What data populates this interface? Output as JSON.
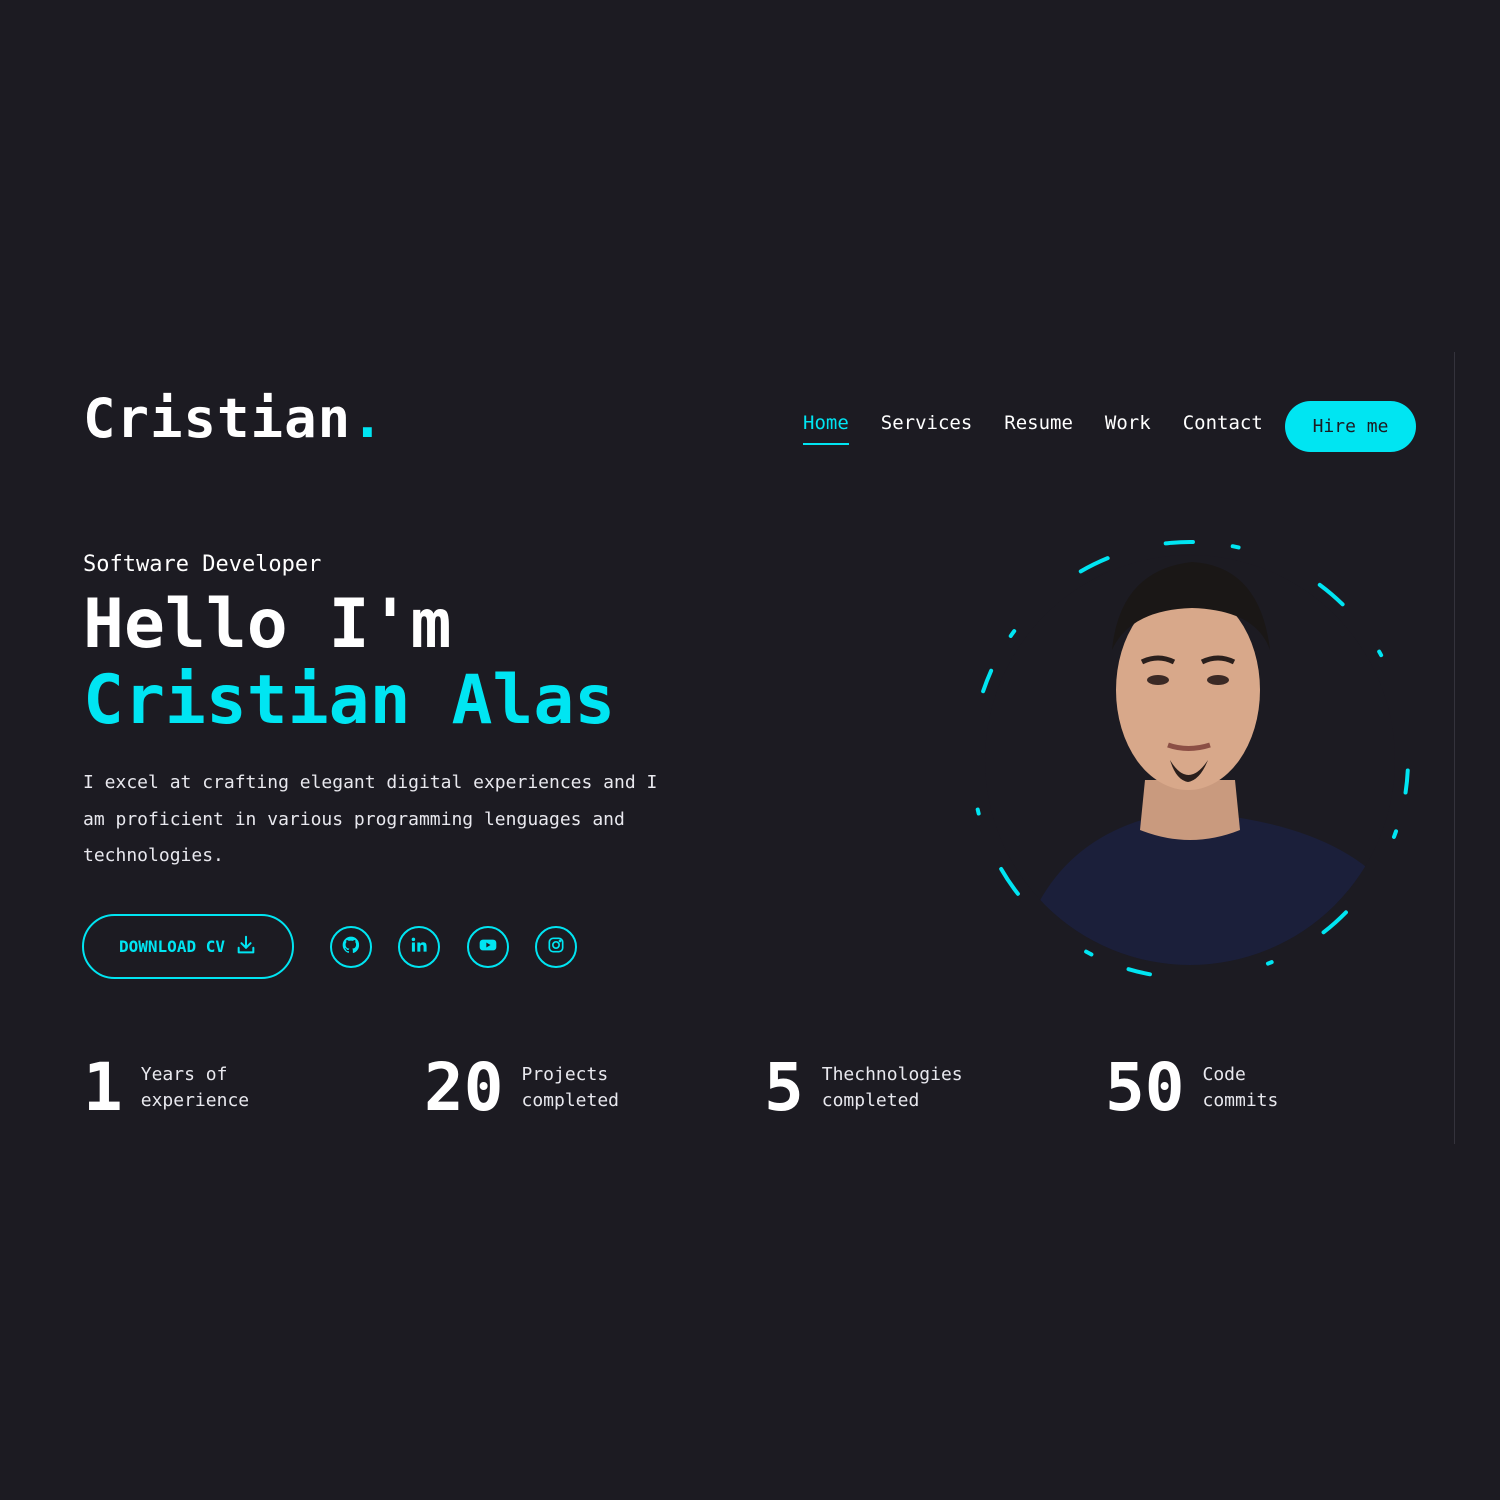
{
  "header": {
    "logo_text": "Cristian",
    "logo_dot": ".",
    "nav": [
      {
        "label": "Home",
        "active": true
      },
      {
        "label": "Services",
        "active": false
      },
      {
        "label": "Resume",
        "active": false
      },
      {
        "label": "Work",
        "active": false
      },
      {
        "label": "Contact",
        "active": false
      }
    ],
    "hire_label": "Hire me"
  },
  "hero": {
    "role": "Software Developer",
    "greeting": "Hello I'm",
    "name": "Cristian Alas",
    "description": "I excel at crafting elegant digital experiences and I am proficient in various programming lenguages and technologies.",
    "download_label": "DOWNLOAD CV",
    "socials": [
      {
        "icon": "github-icon"
      },
      {
        "icon": "linkedin-icon"
      },
      {
        "icon": "youtube-icon"
      },
      {
        "icon": "instagram-icon"
      }
    ]
  },
  "stats": [
    {
      "value": "1",
      "label": "Years of experience"
    },
    {
      "value": "20",
      "label": "Projects completed"
    },
    {
      "value": "5",
      "label": "Thechnologies completed"
    },
    {
      "value": "50",
      "label": "Code commits"
    }
  ],
  "colors": {
    "accent": "#00e5f2",
    "background": "#1c1b22",
    "text": "#ffffff"
  }
}
